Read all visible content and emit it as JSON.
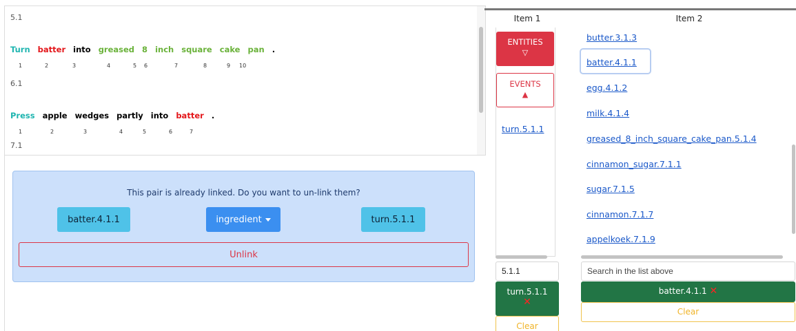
{
  "text_panel": {
    "blocks": [
      {
        "id": "5.1"
      },
      {
        "id": "6.1"
      },
      {
        "id": "7.1"
      }
    ],
    "sentence1": {
      "tokens": [
        "Turn",
        "batter",
        "into",
        "greased",
        "8",
        "inch",
        "square",
        "cake",
        "pan",
        "."
      ],
      "numbers": [
        "1",
        "2",
        "3",
        "4",
        "5",
        "6",
        "7",
        "8",
        "9",
        "10"
      ]
    },
    "sentence2": {
      "tokens": [
        "Press",
        "apple",
        "wedges",
        "partly",
        "into",
        "batter",
        "."
      ],
      "numbers": [
        "1",
        "2",
        "3",
        "4",
        "5",
        "6",
        "7"
      ]
    }
  },
  "link_panel": {
    "message": "This pair is already linked. Do you want to un-link them?",
    "left_item": "batter.4.1.1",
    "relation": "ingredient",
    "right_item": "turn.5.1.1",
    "unlink_label": "Unlink"
  },
  "columns": {
    "item1_header": "Item 1",
    "item2_header": "Item 2",
    "entities_label": "ENTITIES",
    "entities_arrow": "▽",
    "events_label": "EVENTS",
    "events_arrow": "▲",
    "col1_items": [
      "turn.5.1.1"
    ],
    "col2_items": [
      "butter.3.1.3",
      "batter.4.1.1",
      "egg.4.1.2",
      "milk.4.1.4",
      "greased_8_inch_square_cake_pan.5.1.4",
      "cinnamon_sugar.7.1.1",
      "sugar.7.1.5",
      "cinnamon.7.1.7",
      "appelkoek.7.1.9"
    ]
  },
  "bottom": {
    "item1_input_value": "5.1.1",
    "item2_input_placeholder": "Search in the list above",
    "item1_selected": "turn.5.1.1",
    "item2_selected": "batter.4.1.1",
    "remove_symbol": "✕",
    "clear_label": "Clear"
  },
  "colors": {
    "event": "#1fb5b0",
    "entity_linked": "#e3161a",
    "entity_other": "#6ab23a",
    "danger": "#dc3545",
    "selected": "#227545",
    "warning": "#f0b429"
  }
}
